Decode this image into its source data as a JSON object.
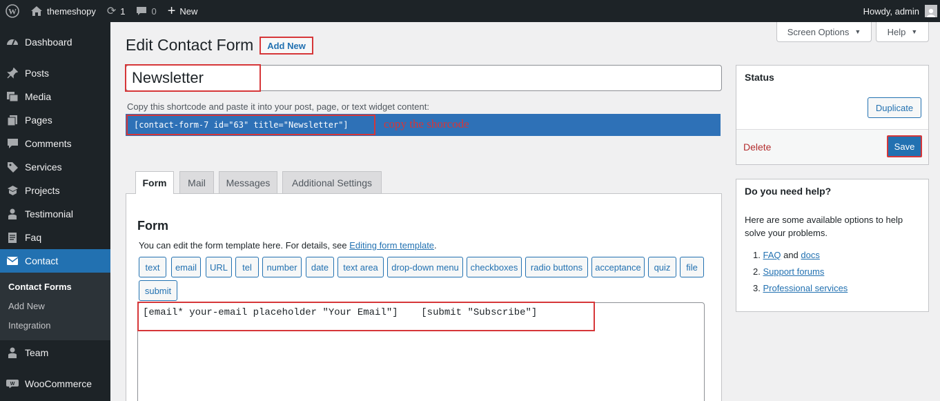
{
  "adminbar": {
    "site_name": "themeshopy",
    "updates_count": "1",
    "comments_count": "0",
    "new_label": "New",
    "howdy": "Howdy, admin"
  },
  "sidebar": {
    "items": [
      {
        "label": "Dashboard",
        "icon": "dashboard-icon"
      },
      {
        "label": "Posts",
        "icon": "pin-icon"
      },
      {
        "label": "Media",
        "icon": "media-icon"
      },
      {
        "label": "Pages",
        "icon": "pages-icon"
      },
      {
        "label": "Comments",
        "icon": "comment-icon"
      },
      {
        "label": "Services",
        "icon": "tag-icon"
      },
      {
        "label": "Projects",
        "icon": "portfolio-icon"
      },
      {
        "label": "Testimonial",
        "icon": "user-icon"
      },
      {
        "label": "Faq",
        "icon": "document-icon"
      },
      {
        "label": "Contact",
        "icon": "email-icon"
      },
      {
        "label": "Team",
        "icon": "user-icon"
      },
      {
        "label": "WooCommerce",
        "icon": "woo-icon"
      }
    ],
    "submenu": [
      "Contact Forms",
      "Add New",
      "Integration"
    ]
  },
  "header": {
    "title": "Edit Contact Form",
    "add_new": "Add New",
    "screen_options": "Screen Options",
    "help": "Help"
  },
  "form_title": "Newsletter",
  "shortcode": {
    "hint": "Copy this shortcode and paste it into your post, page, or text widget content:",
    "code": "[contact-form-7 id=\"63\" title=\"Newsletter\"]",
    "annotation": "copy the shorcode"
  },
  "tabs": [
    "Form",
    "Mail",
    "Messages",
    "Additional Settings"
  ],
  "form_panel": {
    "heading": "Form",
    "desc_prefix": "You can edit the form template here. For details, see ",
    "desc_link": "Editing form template",
    "desc_suffix": ".",
    "tags": [
      "text",
      "email",
      "URL",
      "tel",
      "number",
      "date",
      "text area",
      "drop-down menu",
      "checkboxes",
      "radio buttons",
      "acceptance",
      "quiz",
      "file",
      "submit"
    ],
    "template": "[email* your-email placeholder \"Your Email\"]    [submit \"Subscribe\"]"
  },
  "status_box": {
    "title": "Status",
    "duplicate": "Duplicate",
    "delete": "Delete",
    "save": "Save"
  },
  "help_box": {
    "title": "Do you need help?",
    "text": "Here are some available options to help solve your problems.",
    "items": [
      {
        "num": "1.",
        "link": "FAQ",
        "mid": " and ",
        "link2": "docs"
      },
      {
        "num": "2.",
        "link": "Support forums"
      },
      {
        "num": "3.",
        "link": "Professional services"
      }
    ]
  },
  "colors": {
    "admin_dark": "#1d2327",
    "accent": "#2271b1",
    "annotation_red": "#d63638"
  }
}
